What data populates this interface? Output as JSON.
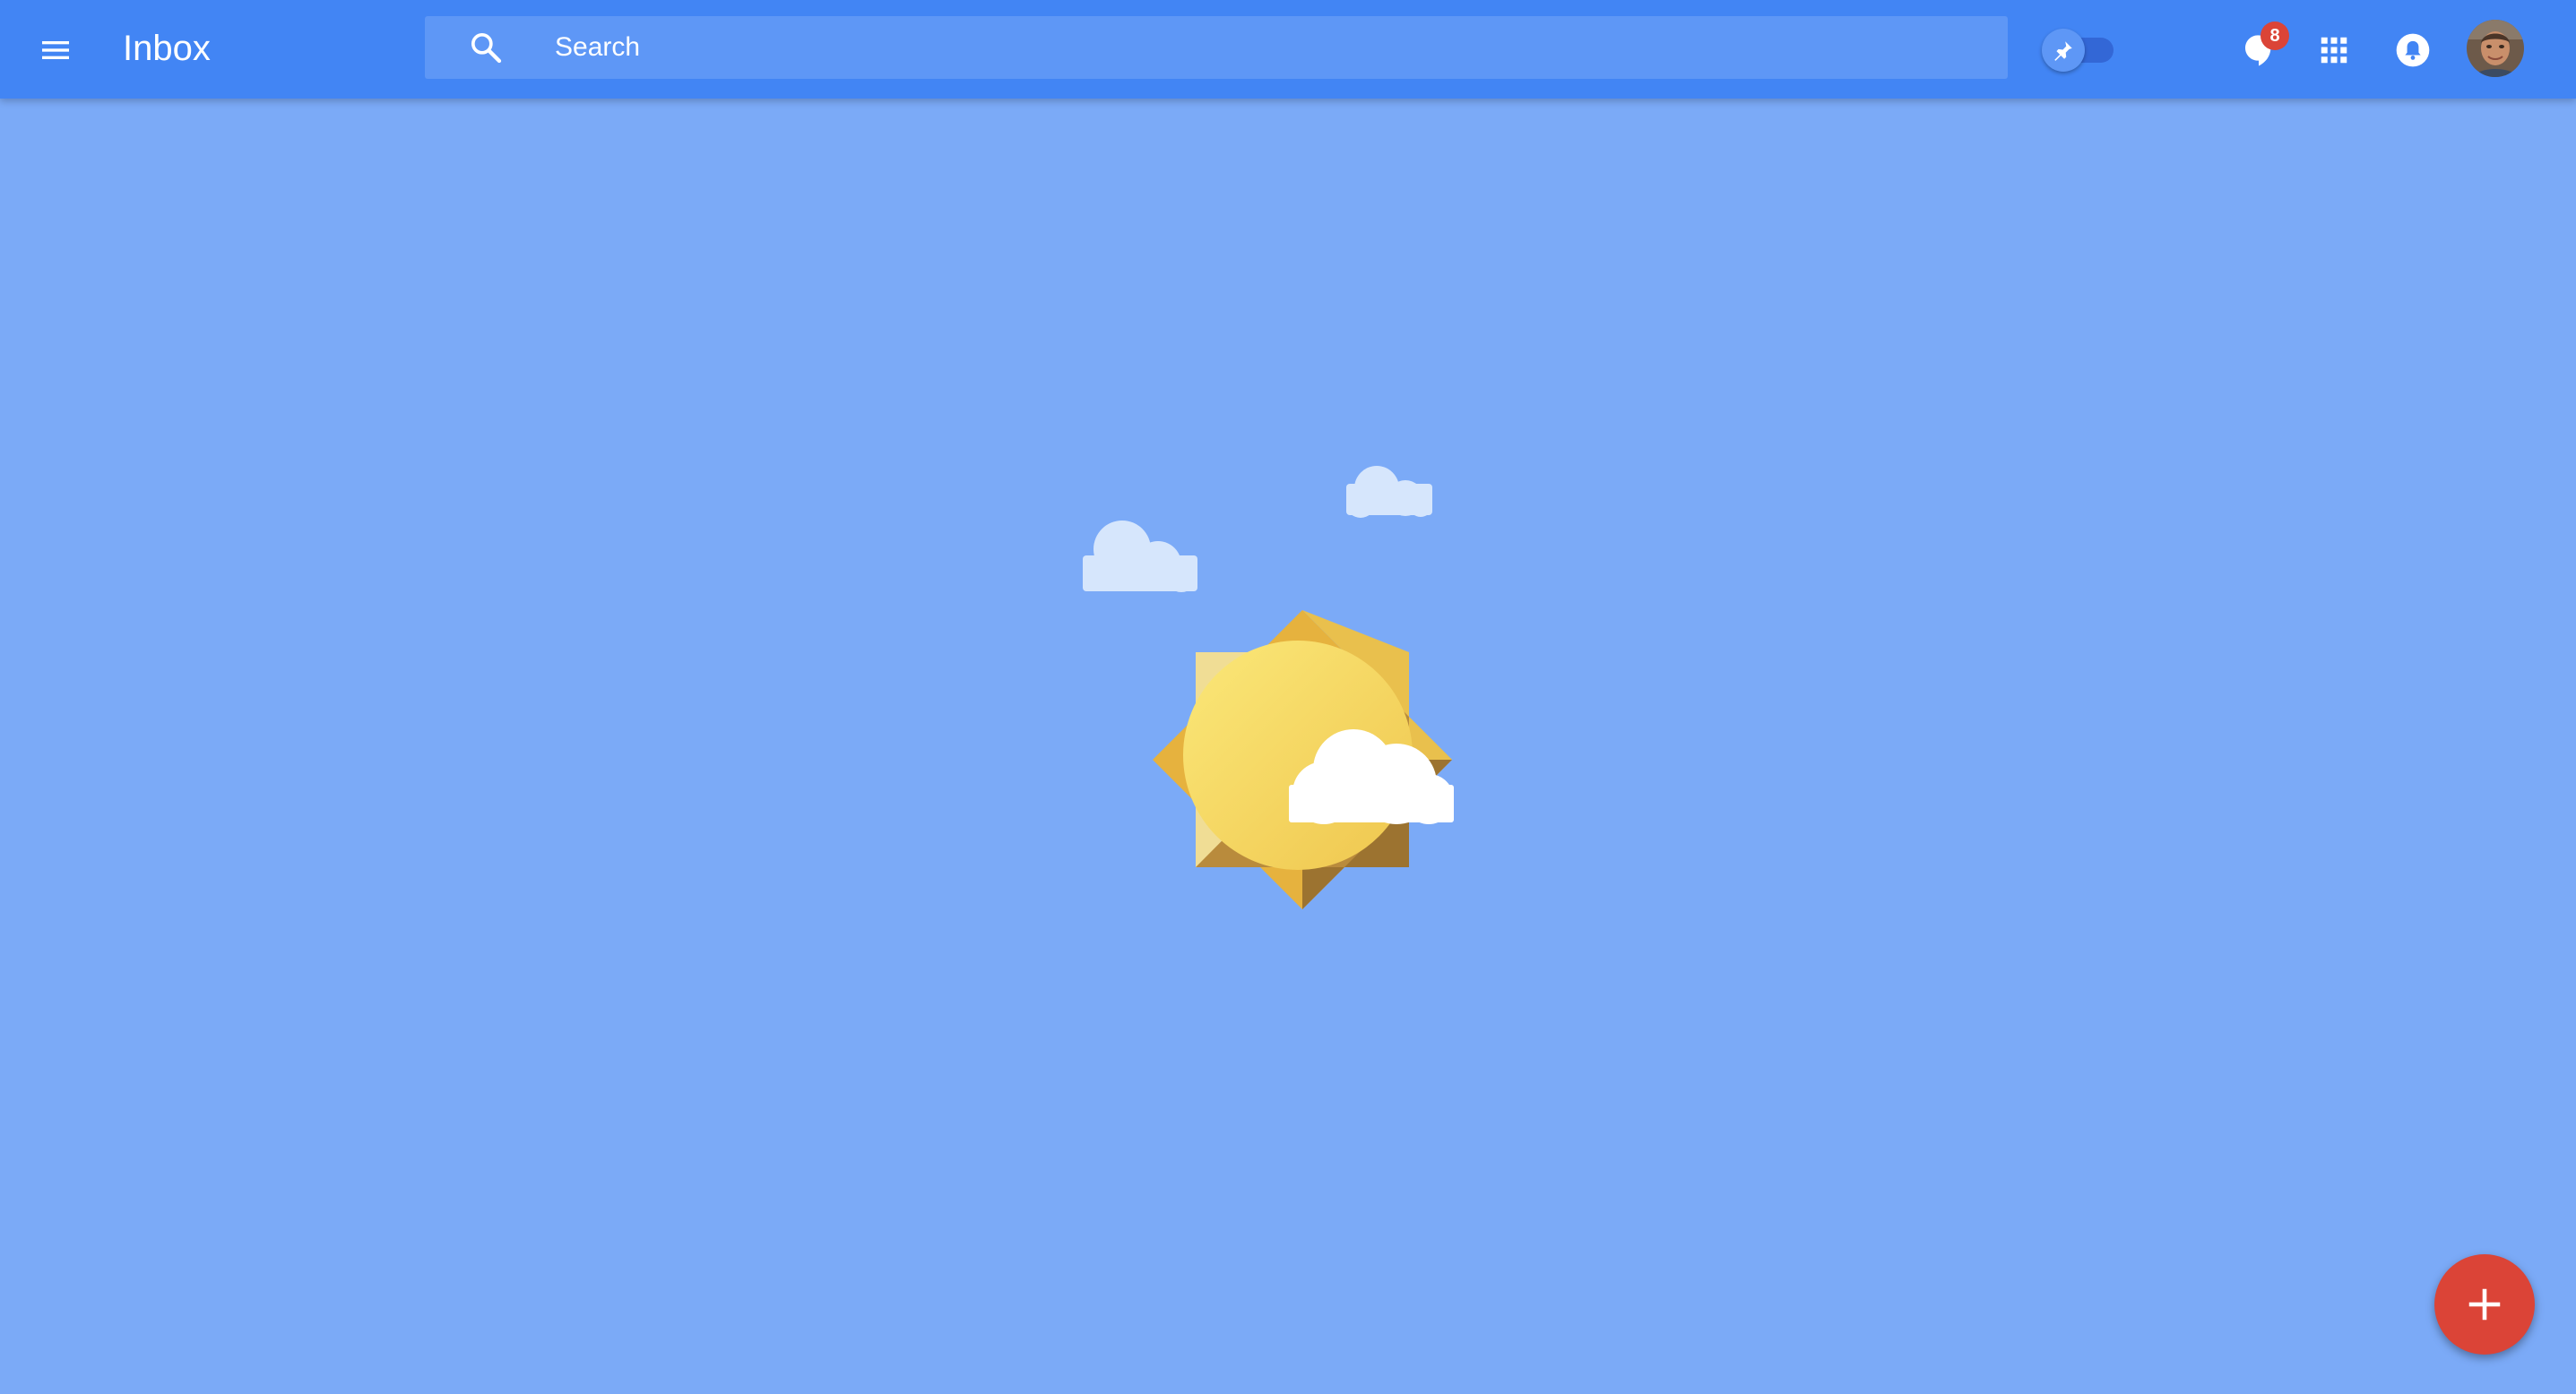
{
  "app": {
    "title": "Inbox"
  },
  "search": {
    "placeholder": "Search",
    "value": ""
  },
  "toolbar": {
    "pin_toggle_on": false,
    "hangouts_badge": "8"
  },
  "icons": {
    "menu": "menu-icon",
    "search": "search-icon",
    "pin": "pin-icon",
    "hangouts": "hangouts-icon",
    "apps": "apps-grid-icon",
    "notifications": "bell-icon",
    "compose": "plus-icon"
  },
  "colors": {
    "header": "#4285f4",
    "background": "#7baaf7",
    "search_bar": "#5e97f6",
    "badge": "#db4437",
    "fab": "#db4437",
    "sun": "#f6d35a",
    "sun_rays": "#e6b23e"
  }
}
